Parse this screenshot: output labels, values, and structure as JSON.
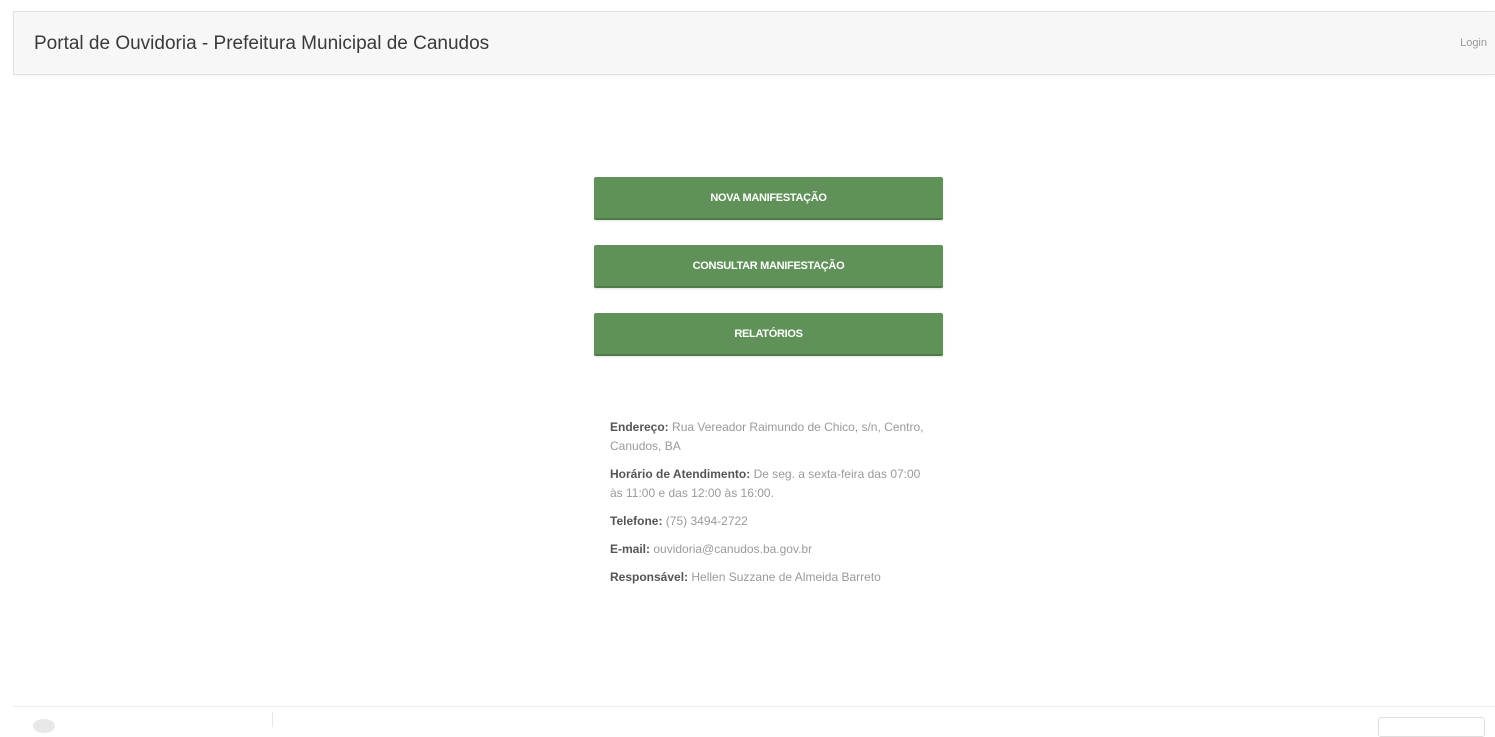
{
  "navbar": {
    "brand": "Portal de Ouvidoria - Prefeitura Municipal de Canudos",
    "login": "Login"
  },
  "actions": {
    "nova": "NOVA MANIFESTAÇÃO",
    "consultar": "CONSULTAR MANIFESTAÇÃO",
    "relatorios": "RELATÓRIOS"
  },
  "info": {
    "endereco_label": "Endereço:",
    "endereco_value": "Rua Vereador Raimundo de Chico, s/n, Centro, Canudos, BA",
    "horario_label": "Horário de Atendimento:",
    "horario_value": "De seg. a sexta-feira das 07:00 às 11:00 e das 12:00 às 16:00.",
    "telefone_label": "Telefone:",
    "telefone_value": "(75) 3494-2722",
    "email_label": "E-mail:",
    "email_value": "ouvidoria@canudos.ba.gov.br",
    "responsavel_label": "Responsável:",
    "responsavel_value": "Hellen Suzzane de Almeida Barreto"
  }
}
